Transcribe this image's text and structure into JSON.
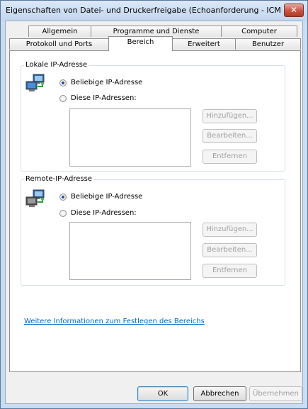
{
  "window": {
    "title": "Eigenschaften von Datei- und Druckerfreigabe (Echoanforderung - ICMP...",
    "close_label": "✕"
  },
  "tabs": {
    "row1": [
      "Allgemein",
      "Programme und Dienste",
      "Computer"
    ],
    "row2": [
      "Protokoll und Ports",
      "Bereich",
      "Erweitert",
      "Benutzer"
    ],
    "active": "Bereich"
  },
  "local": {
    "legend": "Lokale IP-Adresse",
    "icon": "network-computers-icon",
    "option_any": "Beliebige IP-Adresse",
    "option_these": "Diese IP-Adressen:",
    "selected": "any",
    "add": "Hinzufügen...",
    "edit": "Bearbeiten...",
    "remove": "Entfernen"
  },
  "remote": {
    "legend": "Remote-IP-Adresse",
    "icon": "network-computers-icon",
    "option_any": "Beliebige IP-Adresse",
    "option_these": "Diese IP-Adressen:",
    "selected": "any",
    "add": "Hinzufügen...",
    "edit": "Bearbeiten...",
    "remove": "Entfernen"
  },
  "link_text": "Weitere Informationen zum Festlegen des Bereichs",
  "footer": {
    "ok": "OK",
    "cancel": "Abbrechen",
    "apply": "Übernehmen"
  }
}
